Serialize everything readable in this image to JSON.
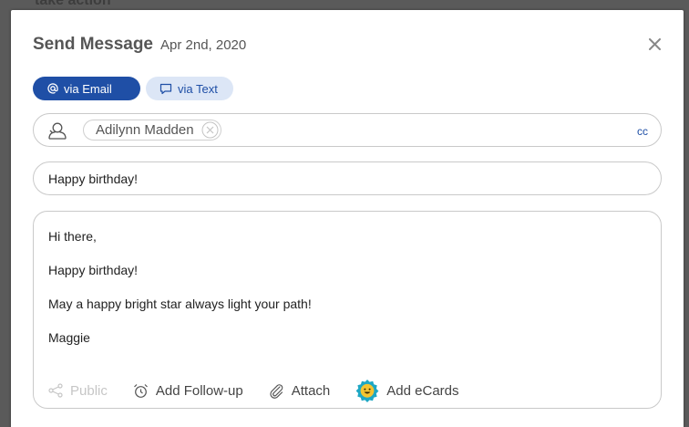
{
  "backdrop": {
    "partial_text": "take action"
  },
  "modal": {
    "title": "Send Message",
    "date": "Apr 2nd, 2020",
    "close_icon": "close-icon"
  },
  "channels": [
    {
      "label": "via Email",
      "icon": "at-sign-icon",
      "active": true
    },
    {
      "label": "via Text",
      "icon": "chat-bubble-icon",
      "active": false
    }
  ],
  "to": {
    "icon": "contact-person-icon",
    "recipients": [
      {
        "name": "Adilynn Madden",
        "remove_icon": "remove-circle-icon"
      }
    ],
    "cc_label": "cc"
  },
  "subject": {
    "value": "Happy birthday!"
  },
  "message": {
    "lines": [
      "Hi there,",
      "Happy birthday!",
      "May a happy bright star always light your path!",
      "Maggie"
    ]
  },
  "toolbar": {
    "public": {
      "label": "Public",
      "icon": "share-icon",
      "enabled": false
    },
    "follow_up": {
      "label": "Add Follow-up",
      "icon": "alarm-clock-icon"
    },
    "attach": {
      "label": "Attach",
      "icon": "paperclip-icon"
    },
    "ecards": {
      "label": "Add eCards",
      "icon": "smiley-badge-icon"
    }
  },
  "colors": {
    "accent": "#1f4fa6",
    "accent_light": "#dce6f6",
    "ecard_badge": "#1ea7c4",
    "ecard_face": "#f4c430"
  }
}
